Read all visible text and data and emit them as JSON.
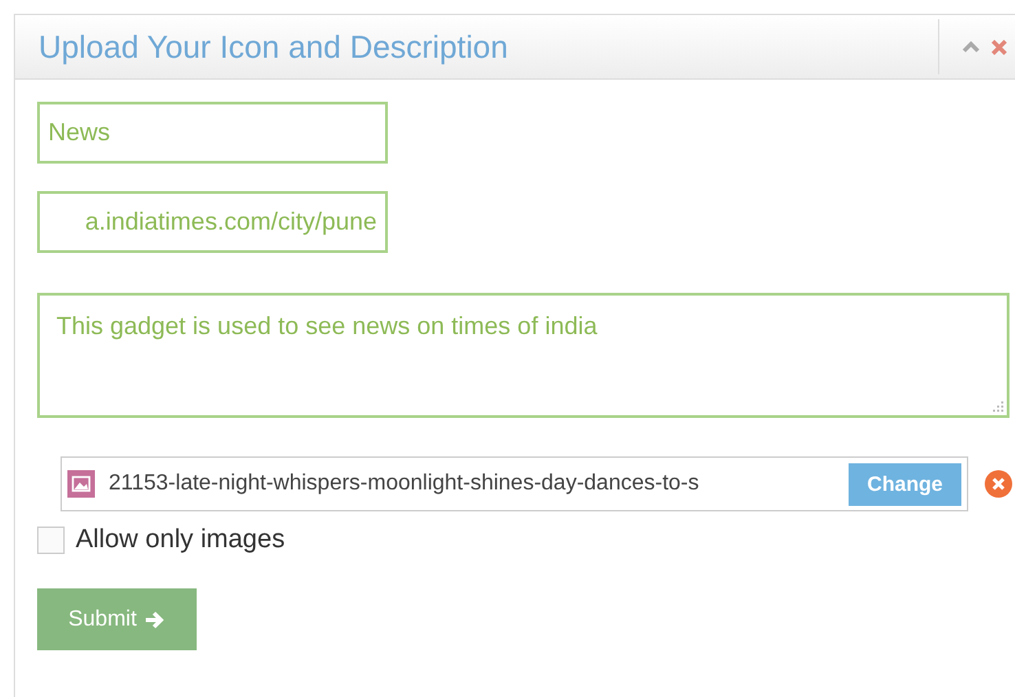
{
  "panel": {
    "title": "Upload Your Icon and Description"
  },
  "fields": [
    {
      "kind": "input",
      "value": "News"
    },
    {
      "kind": "input",
      "value": "a.indiatimes.com/city/pune"
    },
    {
      "kind": "textarea",
      "value": "This gadget is used to see news on times of india"
    }
  ],
  "file": {
    "name": "21153-late-night-whispers-moonlight-shines-day-dances-to-s",
    "button": "Change"
  },
  "checkbox": {
    "label": "Allow only images",
    "checked": false
  },
  "submit": {
    "label": "Submit"
  }
}
